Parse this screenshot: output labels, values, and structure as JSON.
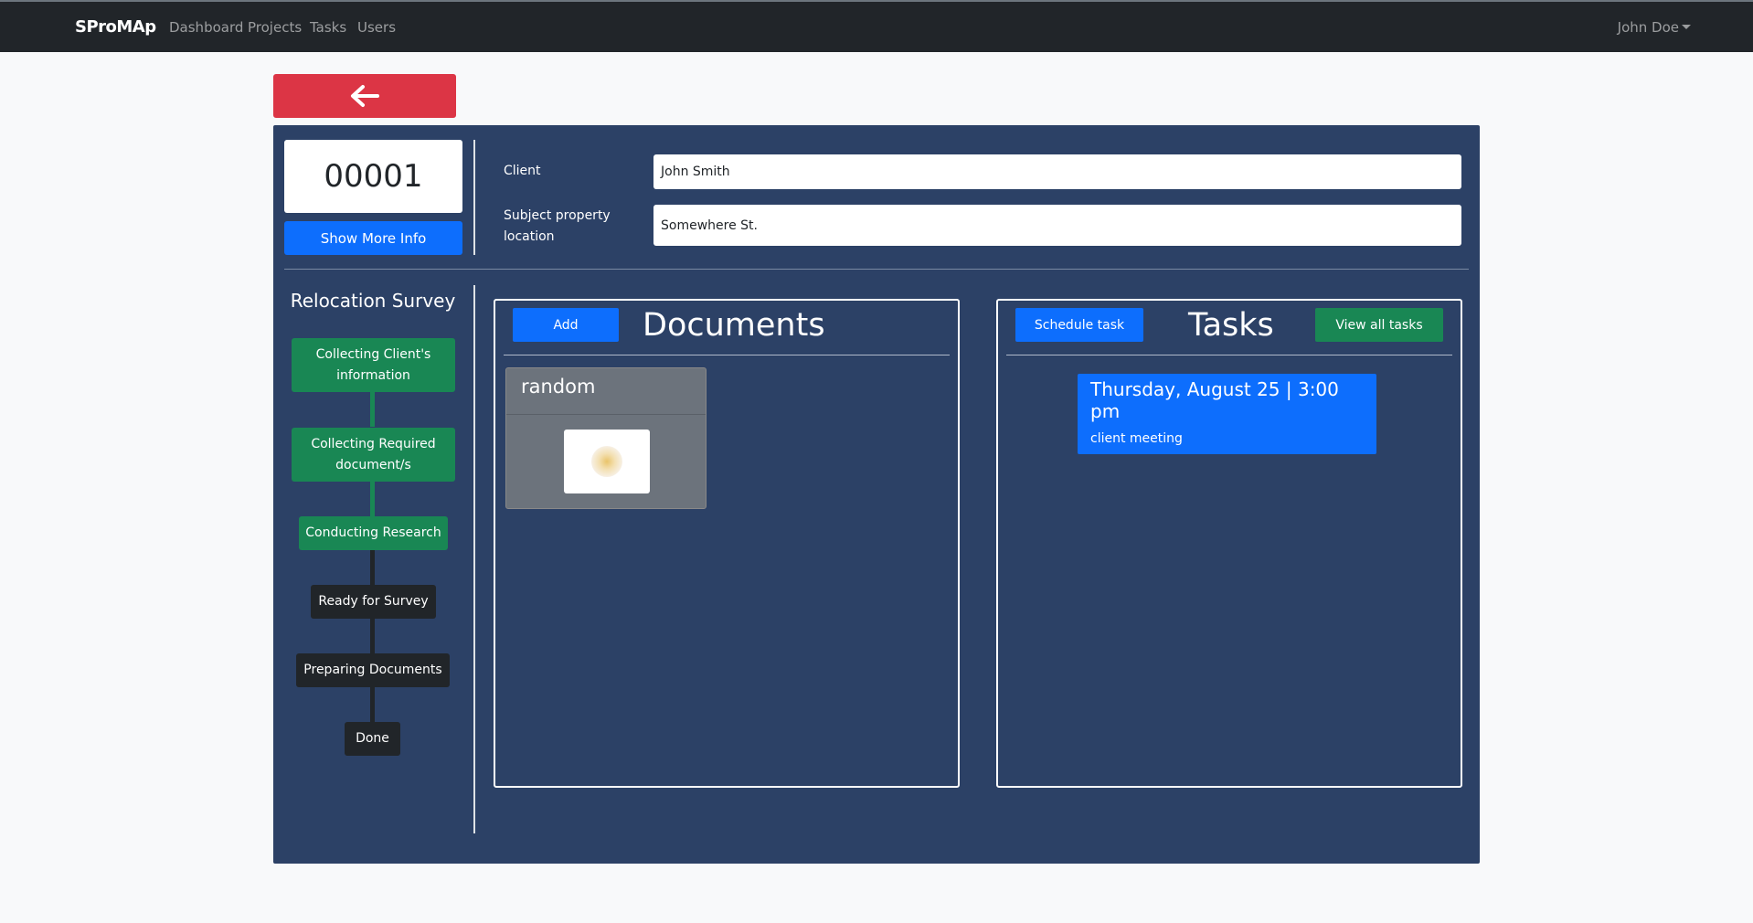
{
  "navbar": {
    "brand": "SProMAp",
    "links": [
      "Dashboard",
      "Projects",
      "Tasks",
      "Users"
    ],
    "user": "John Doe"
  },
  "back_button": {
    "icon": "arrow-left-icon"
  },
  "project": {
    "number": "00001",
    "show_more_label": "Show More Info",
    "fields": [
      {
        "label": "Client",
        "value": "John Smith"
      },
      {
        "label": "Subject property location",
        "value": "Somewhere St."
      }
    ]
  },
  "survey": {
    "title": "Relocation Survey",
    "stages": [
      {
        "label": "Collecting Client's information",
        "status": "done"
      },
      {
        "label": "Collecting Required document/s",
        "status": "done"
      },
      {
        "label": "Conducting Research",
        "status": "done"
      },
      {
        "label": "Ready for Survey",
        "status": "pending"
      },
      {
        "label": "Preparing Documents",
        "status": "pending"
      },
      {
        "label": "Done",
        "status": "pending"
      }
    ]
  },
  "documents": {
    "title": "Documents",
    "add_label": "Add",
    "items": [
      {
        "name": "random"
      }
    ]
  },
  "tasks": {
    "title": "Tasks",
    "schedule_label": "Schedule task",
    "view_all_label": "View all tasks",
    "items": [
      {
        "when": "Thursday, August 25 | 3:00 pm",
        "what": "client meeting"
      }
    ]
  },
  "colors": {
    "navbar": "#212529",
    "panel": "#2c4166",
    "danger": "#dc3545",
    "primary": "#0d6efd",
    "success": "#198754",
    "dark": "#212529"
  }
}
